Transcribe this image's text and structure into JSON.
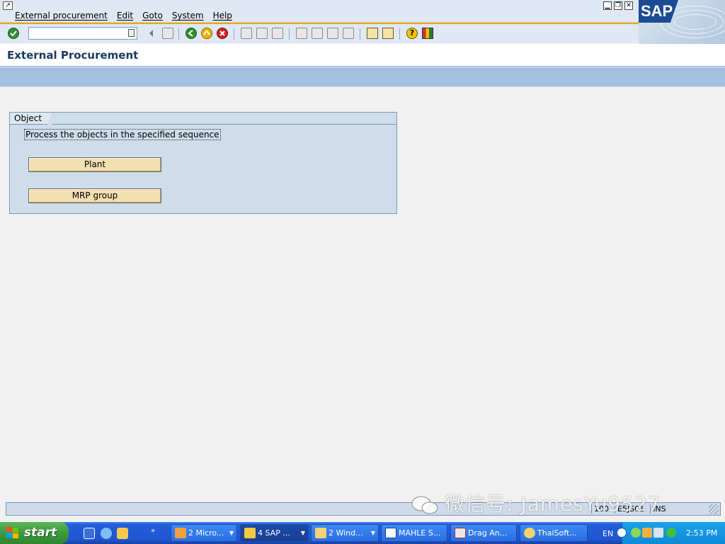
{
  "menu": {
    "items": [
      "External procurement",
      "Edit",
      "Goto",
      "System",
      "Help"
    ]
  },
  "brand": {
    "logo_text": "SAP"
  },
  "toolbar": {
    "command_field_value": ""
  },
  "screen": {
    "title": "External Procurement"
  },
  "object_group": {
    "title": "Object",
    "description": "Process the objects in the specified sequence",
    "buttons": [
      "Plant",
      "MRP group"
    ]
  },
  "statusbar": {
    "fields": [
      "100",
      "E5JS01",
      "INS"
    ]
  },
  "watermark": {
    "text": "微信号: JamesYu9527"
  },
  "taskbar": {
    "start_label": "start",
    "tasks": [
      "2 Micro...",
      "4 SAP ...",
      "2 Wind...",
      "MAHLE S...",
      "Drag An...",
      "ThaiSoft..."
    ],
    "language": "EN",
    "clock": "2:53 PM"
  }
}
